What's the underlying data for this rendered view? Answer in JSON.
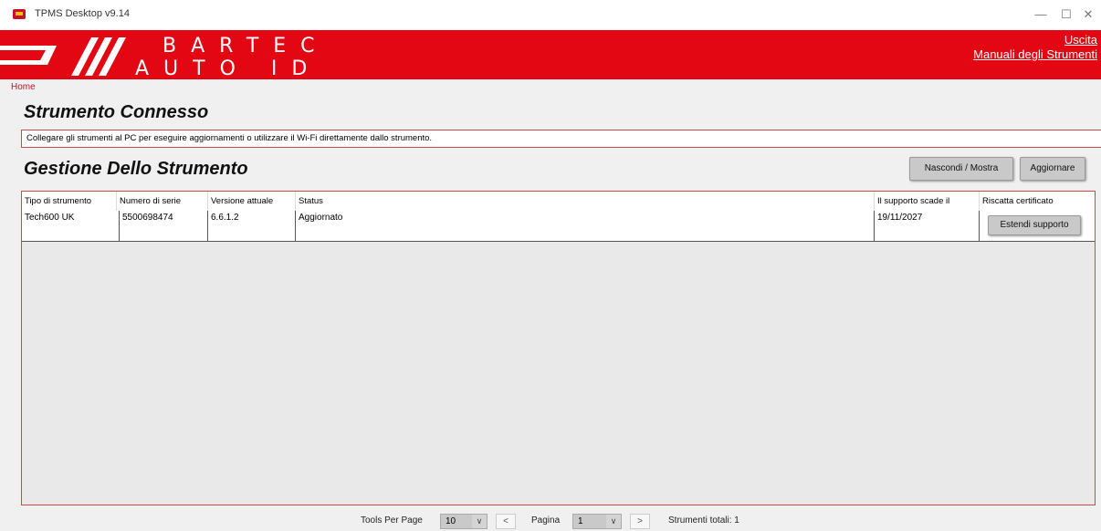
{
  "window": {
    "title": "TPMS Desktop v9.14"
  },
  "header": {
    "brand_line1": "BARTEC",
    "brand_line2": "AUTO ID",
    "logout_link": "Uscita",
    "manuals_link": "Manuali degli Strumenti",
    "brand_color": "#e30613"
  },
  "breadcrumb": "Home",
  "connected": {
    "title": "Strumento Connesso",
    "info": "Collegare gli strumenti al PC per eseguire aggiornamenti o utilizzare il Wi-Fi direttamente dallo strumento."
  },
  "management": {
    "title": "Gestione Dello Strumento",
    "toggle_button": "Nascondi / Mostra",
    "refresh_button": "Aggiornare"
  },
  "table": {
    "columns": [
      "Tipo di strumento",
      "Numero di serie",
      "Versione attuale",
      "Status",
      "Il supporto scade il",
      "Riscatta certificato"
    ],
    "rows": [
      {
        "type": "Tech600 UK",
        "serial": "5500698474",
        "version": "6.6.1.2",
        "status": "Aggiornato",
        "expires": "19/11/2027",
        "action": "Estendi supporto"
      }
    ]
  },
  "pagination": {
    "per_page_label": "Tools Per Page",
    "per_page_value": "10",
    "prev": "<",
    "page_label": "Pagina",
    "page_value": "1",
    "next": ">",
    "total_label": "Strumenti totali: 1"
  }
}
